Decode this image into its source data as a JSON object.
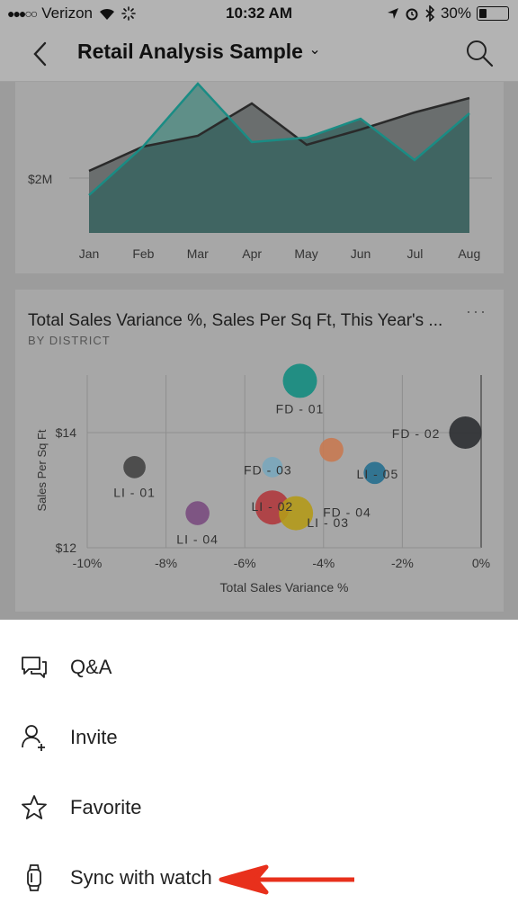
{
  "status_bar": {
    "carrier": "Verizon",
    "time": "10:32 AM",
    "battery": "30%",
    "battery_level": 0.3
  },
  "nav": {
    "title": "Retail Analysis Sample",
    "title_chevron": "⌄",
    "back_icon": "back-chevron-icon",
    "search_icon": "search-icon"
  },
  "area_chart": {
    "type": "area",
    "y_tick_label": "$2M",
    "categories": [
      "Jan",
      "Feb",
      "Mar",
      "Apr",
      "May",
      "Jun",
      "Jul",
      "Aug"
    ],
    "series": [],
    "colors": {
      "teal_line": "#1a8c84",
      "dark_line": "#2a2a2a",
      "area": "#3e6461"
    }
  },
  "card2": {
    "title": "Total Sales Variance %, Sales Per Sq Ft, This Year's ...",
    "subtitle": "BY DISTRICT",
    "more": "···"
  },
  "chart_data": {
    "type": "scatter",
    "xlabel": "Total Sales Variance %",
    "ylabel": "Sales Per Sq Ft",
    "xlim": [
      -10,
      0
    ],
    "ylim": [
      12,
      15
    ],
    "x_ticks": [
      "-10%",
      "-8%",
      "-6%",
      "-4%",
      "-2%",
      "0%"
    ],
    "y_ticks": [
      "$12",
      "$14"
    ],
    "points": [
      {
        "label": "FD - 01",
        "x": -4.6,
        "y": 14.9,
        "color": "#148c80",
        "size": 1.0
      },
      {
        "label": "FD - 02",
        "x": -0.4,
        "y": 14.0,
        "color": "#2c2f32",
        "size": 0.95
      },
      {
        "label": "LI - 05",
        "x": -3.8,
        "y": 13.7,
        "color": "#c87a52",
        "size": 0.7
      },
      {
        "label": "LI - 03",
        "x": -2.7,
        "y": 13.3,
        "color": "#266f8f",
        "size": 0.65
      },
      {
        "label": "FD - 03",
        "x": -5.3,
        "y": 13.4,
        "color": "#7aa7bc",
        "size": 0.6
      },
      {
        "label": "LI - 01",
        "x": -8.8,
        "y": 13.4,
        "color": "#444444",
        "size": 0.65
      },
      {
        "label": "LI - 02",
        "x": -5.3,
        "y": 12.7,
        "color": "#b03a3e",
        "size": 1.0
      },
      {
        "label": "FD - 04",
        "x": -4.7,
        "y": 12.6,
        "color": "#b49a1a",
        "size": 1.0
      },
      {
        "label": "LI - 04",
        "x": -7.2,
        "y": 12.6,
        "color": "#7a4c80",
        "size": 0.7
      }
    ]
  },
  "menu": [
    {
      "label": "Q&A",
      "icon": "chat-bubbles-icon"
    },
    {
      "label": "Invite",
      "icon": "add-person-icon"
    },
    {
      "label": "Favorite",
      "icon": "star-icon"
    },
    {
      "label": "Sync with watch",
      "icon": "watch-icon"
    }
  ],
  "annotation": {
    "arrow_color": "#e8301c"
  }
}
